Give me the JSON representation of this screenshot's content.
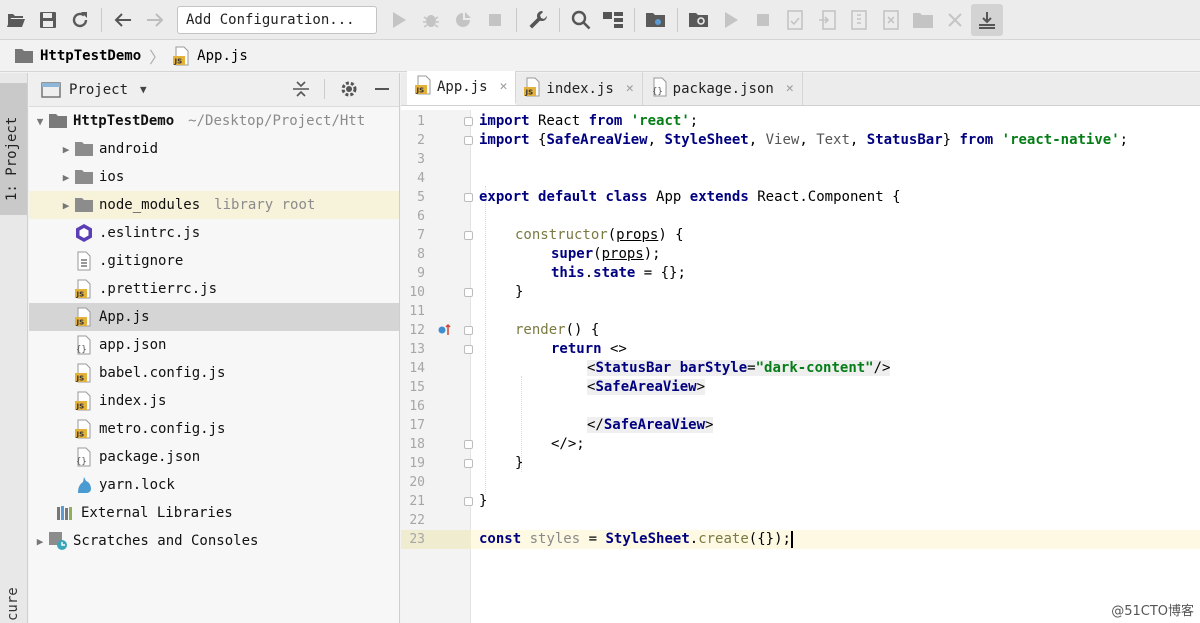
{
  "toolbar": {
    "config_label": "Add Configuration..."
  },
  "breadcrumb": {
    "project": "HttpTestDemo",
    "file": "App.js"
  },
  "tool_strip": {
    "project_tab": "1: Project",
    "bottom_tab": "cure"
  },
  "project_panel": {
    "title": "Project",
    "root": {
      "name": "HttpTestDemo",
      "path": "~/Desktop/Project/Htt"
    },
    "items": [
      {
        "name": "android",
        "kind": "folder",
        "expandable": true
      },
      {
        "name": "ios",
        "kind": "folder",
        "expandable": true
      },
      {
        "name": "node_modules",
        "kind": "folder",
        "expandable": true,
        "hint": "library root"
      },
      {
        "name": ".eslintrc.js",
        "kind": "eslint"
      },
      {
        "name": ".gitignore",
        "kind": "text"
      },
      {
        "name": ".prettierrc.js",
        "kind": "js"
      },
      {
        "name": "App.js",
        "kind": "js",
        "selected": true
      },
      {
        "name": "app.json",
        "kind": "json"
      },
      {
        "name": "babel.config.js",
        "kind": "js"
      },
      {
        "name": "index.js",
        "kind": "js"
      },
      {
        "name": "metro.config.js",
        "kind": "js"
      },
      {
        "name": "package.json",
        "kind": "json"
      },
      {
        "name": "yarn.lock",
        "kind": "yarn"
      }
    ],
    "external_libraries": "External Libraries",
    "scratches": "Scratches and Consoles"
  },
  "editor": {
    "tabs": [
      {
        "label": "App.js",
        "icon": "js-file-icon",
        "active": true
      },
      {
        "label": "index.js",
        "icon": "js-file-icon",
        "active": false
      },
      {
        "label": "package.json",
        "icon": "json-file-icon",
        "active": false
      }
    ],
    "line_numbers": [
      "1",
      "2",
      "3",
      "4",
      "5",
      "6",
      "7",
      "8",
      "9",
      "10",
      "11",
      "12",
      "13",
      "14",
      "15",
      "16",
      "17",
      "18",
      "19",
      "20",
      "21",
      "22",
      "23"
    ],
    "current_line": "23",
    "code": {
      "l1": {
        "kw1": "import",
        "t1": " React ",
        "kw2": "from",
        "t2": " ",
        "s1": "'react'",
        "t3": ";"
      },
      "l2": {
        "kw1": "import",
        "t1": " {",
        "c1": "SafeAreaView",
        "t2": ", ",
        "c2": "StyleSheet",
        "t3": ", ",
        "c3": "View",
        "t4": ", ",
        "c4": "Text",
        "t5": ", ",
        "c5": "StatusBar",
        "t6": "} ",
        "kw2": "from",
        "t7": " ",
        "s1": "'react-native'",
        "t8": ";"
      },
      "l5": {
        "kw1": "export",
        "t1": " ",
        "kw2": "default",
        "t2": " ",
        "kw3": "class",
        "t3": " App ",
        "kw4": "extends",
        "t4": " React.Component {"
      },
      "l7": {
        "fn": "constructor",
        "t1": "(",
        "p": "props",
        "t2": ") {"
      },
      "l8": {
        "kw": "super",
        "t1": "(",
        "p": "props",
        "t2": ");"
      },
      "l9": {
        "kw": "this",
        "t1": ".",
        "prop": "state",
        "t2": " = {};"
      },
      "l10": "}",
      "l12": {
        "fn": "render",
        "t1": "() {"
      },
      "l13": {
        "kw": "return",
        "t1": " <>"
      },
      "l14": {
        "t1": "<",
        "tag": "StatusBar",
        "t2": " ",
        "attr": "barStyle",
        "t3": "=",
        "s": "\"dark-content\"",
        "t4": "/>"
      },
      "l15": {
        "t1": "<",
        "tag": "SafeAreaView",
        "t2": ">"
      },
      "l17": {
        "t1": "</",
        "tag": "SafeAreaView",
        "t2": ">"
      },
      "l18": "</>;",
      "l19": "}",
      "l21": "}",
      "l23": {
        "kw": "const",
        "t1": " ",
        "var": "styles",
        "t2": " = ",
        "cls": "StyleSheet",
        "t3": ".",
        "fn": "create",
        "t4": "({});"
      }
    }
  },
  "watermark": "@51CTO博客"
}
